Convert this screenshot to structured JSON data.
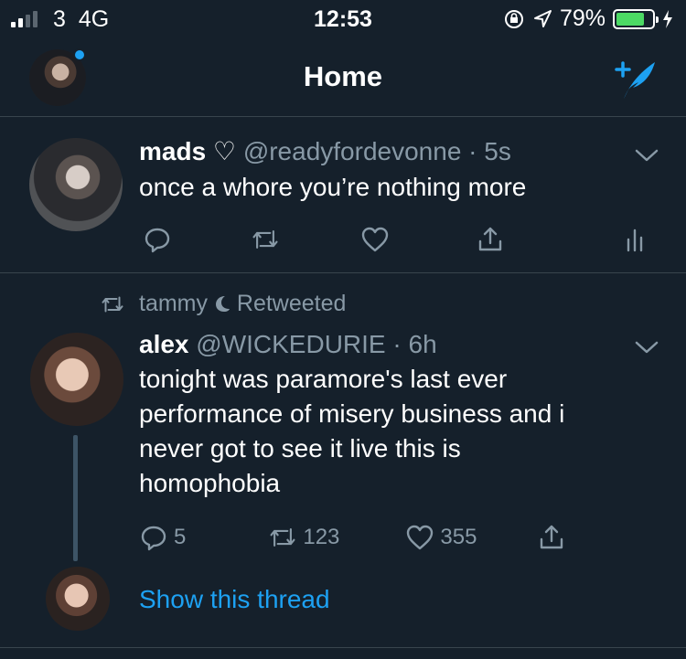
{
  "status_bar": {
    "carrier": "3",
    "network": "4G",
    "time": "12:53",
    "battery": "79%",
    "battery_level": 0.79
  },
  "nav": {
    "title": "Home",
    "has_notification_dot": true
  },
  "tweets": [
    {
      "name": "mads ♡",
      "handle": "@readyfordevonne",
      "time": "5s",
      "text": "once a whore you’re nothing more"
    },
    {
      "retweeted_by": "tammy",
      "retweeted_label": "Retweeted",
      "name": "alex",
      "handle": "@WICKEDURIE",
      "time": "6h",
      "text_lines": [
        "tonight was paramore's last ever",
        "performance of misery business and i",
        "never got to see it live this is",
        "homophobia"
      ],
      "reply_count": "5",
      "retweet_count": "123",
      "like_count": "355",
      "show_thread": "Show this thread"
    }
  ],
  "colors": {
    "background": "#15202b",
    "divider": "#38444d",
    "secondary_text": "#8899a6",
    "accent": "#1da1f2"
  }
}
